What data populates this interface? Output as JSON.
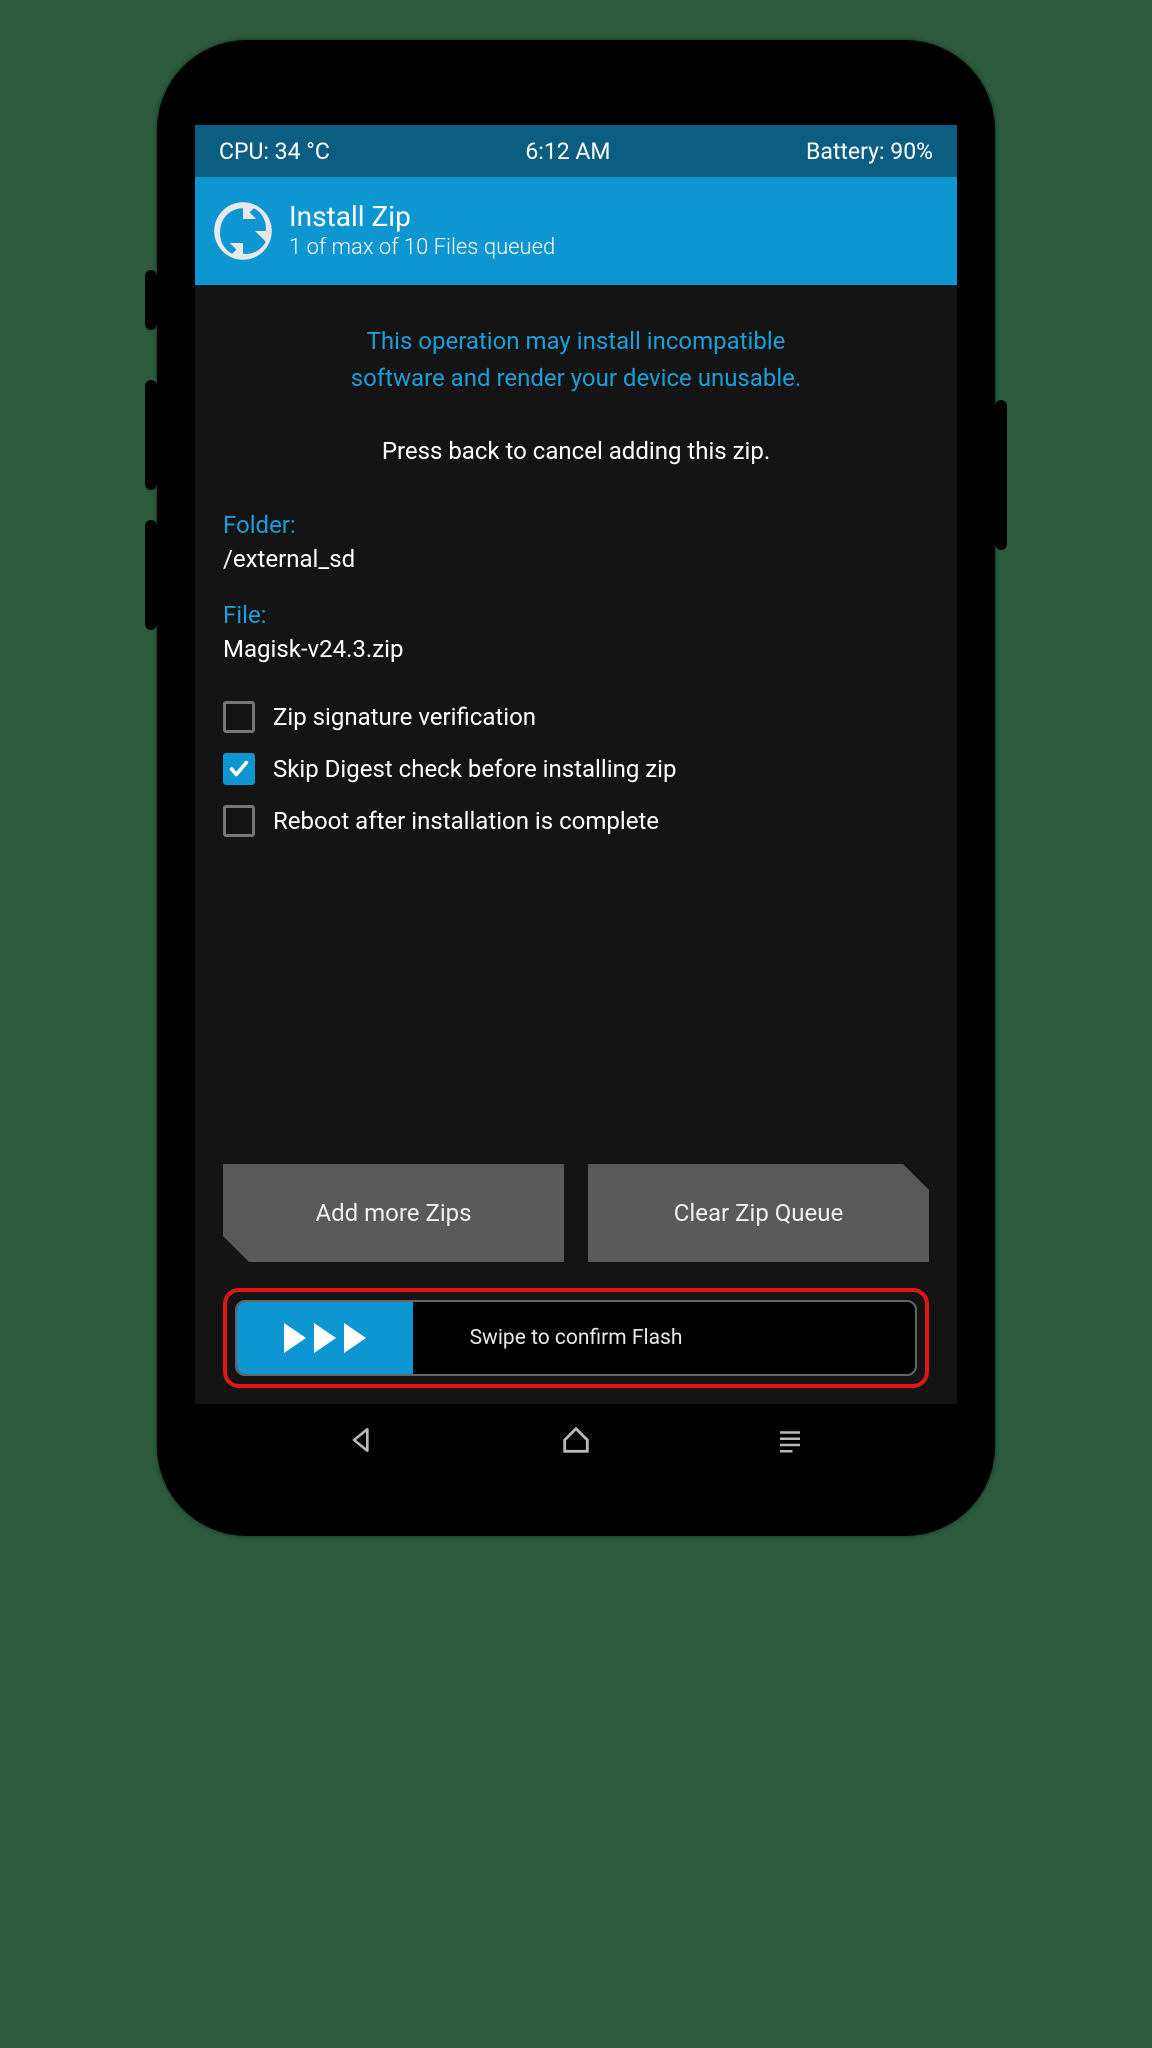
{
  "status": {
    "cpu": "CPU: 34 °C",
    "time": "6:12 AM",
    "battery": "Battery: 90%"
  },
  "header": {
    "title": "Install Zip",
    "subtitle": "1 of max of 10 Files queued"
  },
  "warning_line1": "This operation may install incompatible",
  "warning_line2": "software and render your device unusable.",
  "cancel_hint": "Press back to cancel adding this zip.",
  "folder_label": "Folder:",
  "folder_value": "/external_sd",
  "file_label": "File:",
  "file_value": "Magisk-v24.3.zip",
  "options": {
    "zip_sig": {
      "label": "Zip signature verification",
      "checked": false
    },
    "skip_digest": {
      "label": "Skip Digest check before installing zip",
      "checked": true
    },
    "reboot_after": {
      "label": "Reboot after installation is complete",
      "checked": false
    }
  },
  "buttons": {
    "add_more": "Add more Zips",
    "clear_queue": "Clear Zip Queue",
    "swipe": "Swipe to confirm Flash"
  }
}
